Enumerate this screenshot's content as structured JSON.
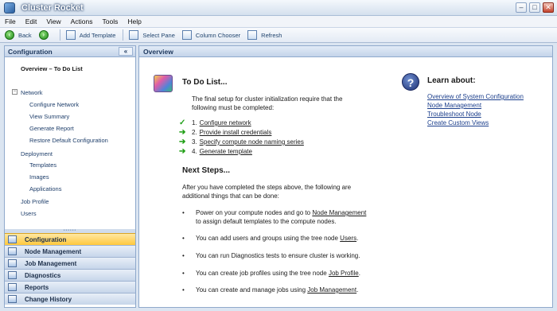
{
  "window": {
    "title": "Cluster Rocket",
    "controls": {
      "minimize": "–",
      "maximize": "□",
      "close": "✕"
    }
  },
  "menu": [
    "File",
    "Edit",
    "View",
    "Actions",
    "Tools",
    "Help"
  ],
  "toolbar": {
    "back": "Back",
    "add_template": "Add Template",
    "select_pane": "Select Pane",
    "column_chooser": "Column Chooser",
    "refresh": "Refresh"
  },
  "left_pane": {
    "title": "Configuration",
    "collapse": "«",
    "tree": {
      "overview": "Overview – To Do List",
      "network": "Network",
      "network_toggle": "−",
      "configure_network": "Configure Network",
      "view_summary": "View Summary",
      "generate_report": "Generate Report",
      "restore_default": "Restore Default Configuration",
      "deployment": "Deployment",
      "templates": "Templates",
      "images": "Images",
      "applications": "Applications",
      "job_profile": "Job Profile",
      "users": "Users"
    },
    "grip": "••••••",
    "nav": [
      "Configuration",
      "Node Management",
      "Job Management",
      "Diagnostics",
      "Reports",
      "Change History"
    ]
  },
  "overview": {
    "title": "Overview",
    "todo_title": "To Do List...",
    "todo_intro_1": "The final setup for cluster initialization require that the",
    "todo_intro_2": "following must be completed:",
    "todo_items": [
      {
        "num": "1.",
        "text": "Configure network",
        "status": "done"
      },
      {
        "num": "2.",
        "text": "Provide install credentials",
        "status": "pending"
      },
      {
        "num": "3.",
        "text": "Specify compute node naming series",
        "status": "pending"
      },
      {
        "num": "4.",
        "text": "Generate template",
        "status": "pending"
      }
    ],
    "check_glyph": "✓",
    "arrow_glyph": "➔",
    "next_title": "Next Steps...",
    "next_intro_1": "After you have completed the steps above, the following are",
    "next_intro_2": "additional things that can be done:",
    "bullet": "•",
    "steps": [
      {
        "pre": "Power on your compute nodes and go to ",
        "link": "Node Management",
        "post": "",
        "line2": "to assign default templates to the compute nodes."
      },
      {
        "pre": "You can add users and groups using the tree node ",
        "link": "Users",
        "post": ".",
        "line2": ""
      },
      {
        "pre": "You can run Diagnostics tests to ensure cluster is working.",
        "link": "",
        "post": "",
        "line2": ""
      },
      {
        "pre": "You can create job profiles using the tree node ",
        "link": "Job Profile",
        "post": ".",
        "line2": ""
      },
      {
        "pre": "You can create and manage jobs using ",
        "link": "Job Management",
        "post": ".",
        "line2": ""
      }
    ],
    "learn_title": "Learn about:",
    "help_glyph": "?",
    "learn_links": [
      "Overview of System Configuration",
      "Node Management",
      "Troubleshoot Node",
      "Create Custom Views"
    ]
  }
}
